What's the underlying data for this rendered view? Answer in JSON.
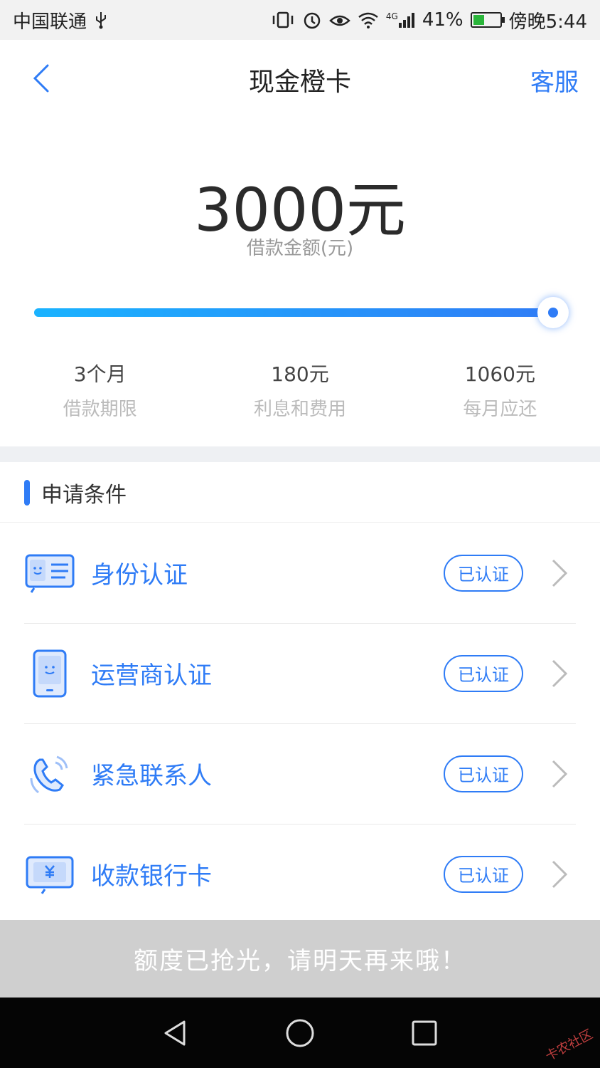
{
  "status_bar": {
    "carrier": "中国联通",
    "network": "4G",
    "battery_percent": "41%",
    "battery_level": 0.41,
    "time": "傍晚5:44"
  },
  "nav": {
    "title": "现金橙卡",
    "service_label": "客服"
  },
  "loan": {
    "amount": "3000元",
    "amount_label": "借款金额(元)",
    "slider_fraction": 1.0
  },
  "stats": [
    {
      "value": "3个月",
      "label": "借款期限"
    },
    {
      "value": "180元",
      "label": "利息和费用"
    },
    {
      "value": "1060元",
      "label": "每月应还"
    }
  ],
  "conditions": {
    "title": "申请条件",
    "items": [
      {
        "label": "身份认证",
        "status": "已认证",
        "icon": "id-card-icon"
      },
      {
        "label": "运营商认证",
        "status": "已认证",
        "icon": "phone-icon"
      },
      {
        "label": "紧急联系人",
        "status": "已认证",
        "icon": "telephone-icon"
      },
      {
        "label": "收款银行卡",
        "status": "已认证",
        "icon": "bank-card-icon"
      }
    ]
  },
  "quota_message": "额度已抢光，请明天再来哦！",
  "watermark": "卡农社区",
  "colors": {
    "accent": "#2f7cf6",
    "disabled_button": "#cfcfcf",
    "section_band": "#eef0f3"
  }
}
